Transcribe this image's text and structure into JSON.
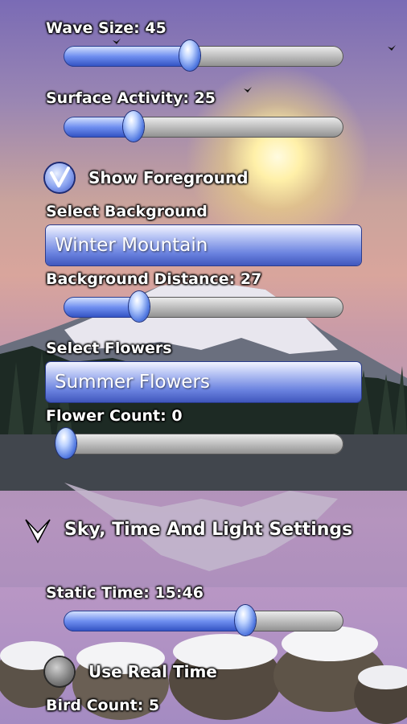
{
  "background": {
    "sky_top": "#7a6bb5",
    "sun_color": "#fff0a8",
    "accent": "#4f77e0"
  },
  "settings": {
    "wave_size": {
      "label": "Wave Size: 45",
      "value": 45,
      "max": 100
    },
    "surface_activity": {
      "label": "Surface Activity: 25",
      "value": 25,
      "max": 100
    },
    "show_foreground": {
      "label": "Show Foreground",
      "checked": true
    },
    "select_background": {
      "label": "Select Background",
      "value": "Winter Mountain"
    },
    "background_distance": {
      "label": "Background Distance: 27",
      "value": 27,
      "max": 100
    },
    "select_flowers": {
      "label": "Select Flowers",
      "value": "Summer Flowers"
    },
    "flower_count": {
      "label": "Flower Count: 0",
      "value": 0,
      "max": 100
    },
    "sky_section": {
      "title": "Sky, Time And Light Settings",
      "icon": "chevron-down-icon"
    },
    "static_time": {
      "label": "Static Time: 15:46",
      "value": 0.66
    },
    "use_real_time": {
      "label": "Use Real Time",
      "checked": false
    },
    "bird_count": {
      "label": "Bird Count: 5"
    }
  }
}
